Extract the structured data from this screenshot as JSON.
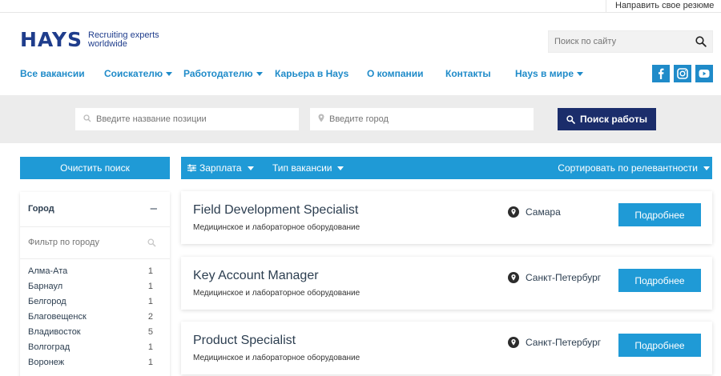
{
  "header": {
    "send_cv_link": "Направить свое резюме",
    "logo_text": "HAYS",
    "logo_tagline_1": "Recruiting experts",
    "logo_tagline_2": "worldwide",
    "site_search_placeholder": "Поиск по сайту"
  },
  "nav": [
    {
      "label": "Все вакансии",
      "has_dropdown": false
    },
    {
      "label": "Соискателю",
      "has_dropdown": true
    },
    {
      "label": "Работодателю",
      "has_dropdown": true
    },
    {
      "label": "Карьера в Hays",
      "has_dropdown": false
    },
    {
      "label": "О компании",
      "has_dropdown": false
    },
    {
      "label": "Контакты",
      "has_dropdown": false
    },
    {
      "label": "Hays в мире",
      "has_dropdown": true
    }
  ],
  "social": [
    "facebook-icon",
    "instagram-icon",
    "youtube-icon"
  ],
  "search": {
    "position_placeholder": "Введите название позиции",
    "city_placeholder": "Введите город",
    "button_label": "Поиск работы"
  },
  "sidebar": {
    "clear_button": "Очистить поиск",
    "filter_title": "Город",
    "filter_toggle": "–",
    "filter_placeholder": "Фильтр по городу",
    "cities": [
      {
        "name": "Алма-Ата",
        "count": "1"
      },
      {
        "name": "Барнаул",
        "count": "1"
      },
      {
        "name": "Белгород",
        "count": "1"
      },
      {
        "name": "Благовещенск",
        "count": "2"
      },
      {
        "name": "Владивосток",
        "count": "5"
      },
      {
        "name": "Волгоград",
        "count": "1"
      },
      {
        "name": "Воронеж",
        "count": "1"
      }
    ]
  },
  "toolbar": {
    "salary_label": "Зарплата",
    "type_label": "Тип вакансии",
    "sort_label": "Сортировать по релевантности"
  },
  "jobs": [
    {
      "title": "Field Development Specialist",
      "sector": "Медицинское и лабораторное оборудование",
      "location": "Самара",
      "button": "Подробнее"
    },
    {
      "title": "Key Account Manager",
      "sector": "Медицинское и лабораторное оборудование",
      "location": "Санкт-Петербург",
      "button": "Подробнее"
    },
    {
      "title": "Product Specialist",
      "sector": "Медицинское и лабораторное оборудование",
      "location": "Санкт-Петербург",
      "button": "Подробнее"
    }
  ],
  "colors": {
    "brand_navy": "#1f3d8c",
    "accent_blue": "#1f9ad6",
    "search_button": "#1b2d6b",
    "band_gray": "#ececec"
  }
}
